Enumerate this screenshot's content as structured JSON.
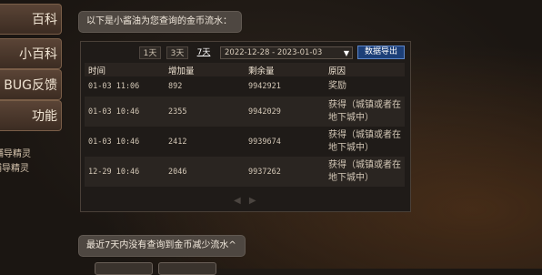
{
  "sidebar": {
    "items": [
      {
        "label": "百科"
      },
      {
        "label": "小百科"
      },
      {
        "label": "BUG反馈"
      },
      {
        "label": "功能"
      }
    ],
    "links": [
      {
        "label": "辅导精灵"
      },
      {
        "label": "辅导精灵"
      }
    ]
  },
  "chat": {
    "intro": "以下是小酱油为您查询的金币流水：",
    "footer": "最近7天内没有查询到金币减少流水^"
  },
  "panel": {
    "range_buttons": [
      "1天",
      "3天",
      "7天"
    ],
    "selected_range": "7天",
    "date_range": "2022-12-28 - 2023-01-03",
    "export_label": "数据导出",
    "columns": [
      "时间",
      "增加量",
      "剩余量",
      "原因"
    ],
    "rows": [
      {
        "time": "01-03 11:06",
        "gain": "892",
        "remain": "9942921",
        "reason": "奖励"
      },
      {
        "time": "01-03 10:46",
        "gain": "2355",
        "remain": "9942029",
        "reason": "获得（城镇或者在地下城中）"
      },
      {
        "time": "01-03 10:46",
        "gain": "2412",
        "remain": "9939674",
        "reason": "获得（城镇或者在地下城中）"
      },
      {
        "time": "12-29 10:46",
        "gain": "2046",
        "remain": "9937262",
        "reason": "获得（城镇或者在地下城中）"
      }
    ],
    "pager": {
      "prev": "◀",
      "next": "▶"
    }
  }
}
